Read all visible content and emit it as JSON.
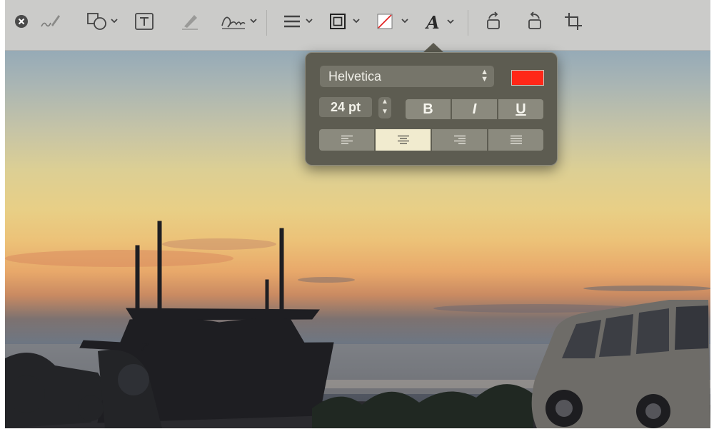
{
  "toolbar": {
    "tools": [
      {
        "name": "close-icon"
      },
      {
        "name": "sketch-icon"
      },
      {
        "name": "shapes-icon"
      },
      {
        "name": "text-box-icon"
      },
      {
        "name": "highlight-icon"
      },
      {
        "name": "signature-icon"
      },
      {
        "name": "line-style-icon"
      },
      {
        "name": "border-color-icon"
      },
      {
        "name": "fill-color-icon"
      },
      {
        "name": "text-style-icon"
      },
      {
        "name": "rotate-right-icon"
      },
      {
        "name": "rotate-left-icon"
      },
      {
        "name": "crop-icon"
      }
    ]
  },
  "text_style_popover": {
    "font": "Helvetica",
    "size": "24 pt",
    "color": "#ff2718",
    "bold_label": "B",
    "italic_label": "I",
    "underline_label": "U",
    "alignment": "center",
    "alignments": [
      "left",
      "center",
      "right",
      "justify"
    ]
  },
  "colors": {
    "toolbar_bg": "#cbcbc9",
    "popover_bg": "#5d5c51",
    "active_align": "#f1ebcf"
  }
}
